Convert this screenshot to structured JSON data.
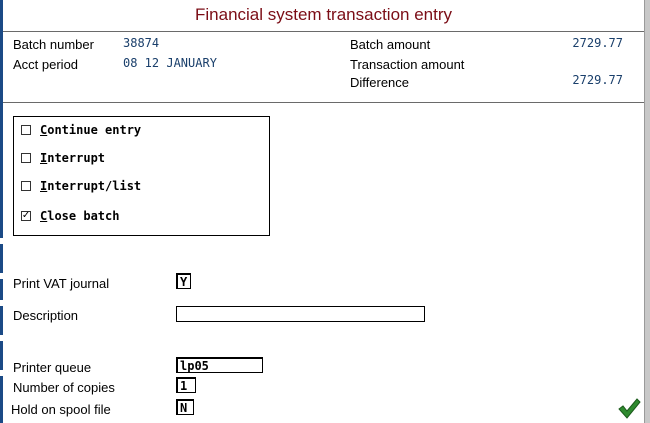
{
  "window": {
    "title": "Financial system transaction entry",
    "title_color": "#7b0d16",
    "value_color": "#1a3f6b"
  },
  "batch": {
    "batch_number_label": "Batch number",
    "batch_number": "38874",
    "acct_period_label": "Acct period",
    "acct_period": "08 12 JANUARY",
    "batch_amount_label": "Batch amount",
    "batch_amount": "2729.77",
    "transaction_amount_label": "Transaction amount",
    "transaction_amount": "",
    "difference_label": "Difference",
    "difference": "2729.77"
  },
  "options": [
    {
      "hotkey": "C",
      "rest": "ontinue entry",
      "checked": false
    },
    {
      "hotkey": "I",
      "rest": "nterrupt",
      "checked": false
    },
    {
      "hotkey": "I",
      "rest": "nterrupt/list",
      "checked": false
    },
    {
      "hotkey": "C",
      "rest": "lose batch",
      "checked": true
    }
  ],
  "form": {
    "print_vat_label": "Print VAT journal",
    "print_vat_value": "Y",
    "description_label": "Description",
    "description_value": "",
    "printer_queue_label": "Printer queue",
    "printer_queue_value": "lp05",
    "copies_label": "Number of copies",
    "copies_value": "1",
    "hold_label": "Hold on spool file",
    "hold_value": "N"
  },
  "icons": {
    "ok": "checkmark-icon",
    "ok_color": "#2e8a2e"
  }
}
